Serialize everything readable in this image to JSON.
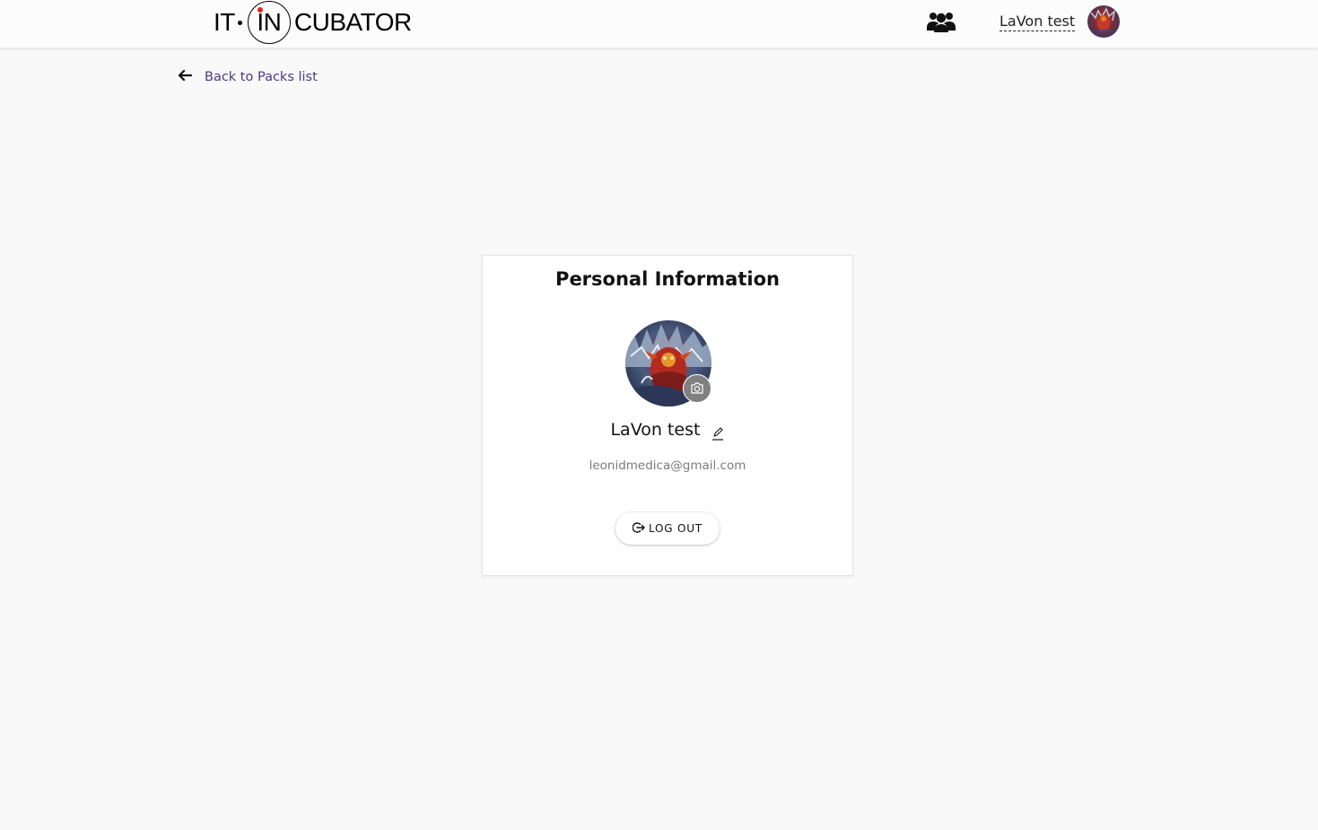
{
  "header": {
    "logo": {
      "part1": "IT",
      "part2": "IN",
      "part3": "CUBATOR"
    },
    "user_name": "LaVon test",
    "icons": {
      "users": "users-icon",
      "avatar": "avatar"
    }
  },
  "navigation": {
    "back_label": "Back to Packs list",
    "back_icon": "arrow-left-icon"
  },
  "profile": {
    "title": "Personal Information",
    "name": "LaVon test",
    "email": "leonidmedica@gmail.com",
    "logout_label": "LOG OUT",
    "icons": {
      "camera": "camera-icon",
      "edit": "pencil-icon",
      "logout": "logout-icon"
    }
  },
  "colors": {
    "background": "#f9f9fa",
    "link": "#4a3a82",
    "logo_accent": "#e2231a",
    "camera_button": "#808080"
  }
}
